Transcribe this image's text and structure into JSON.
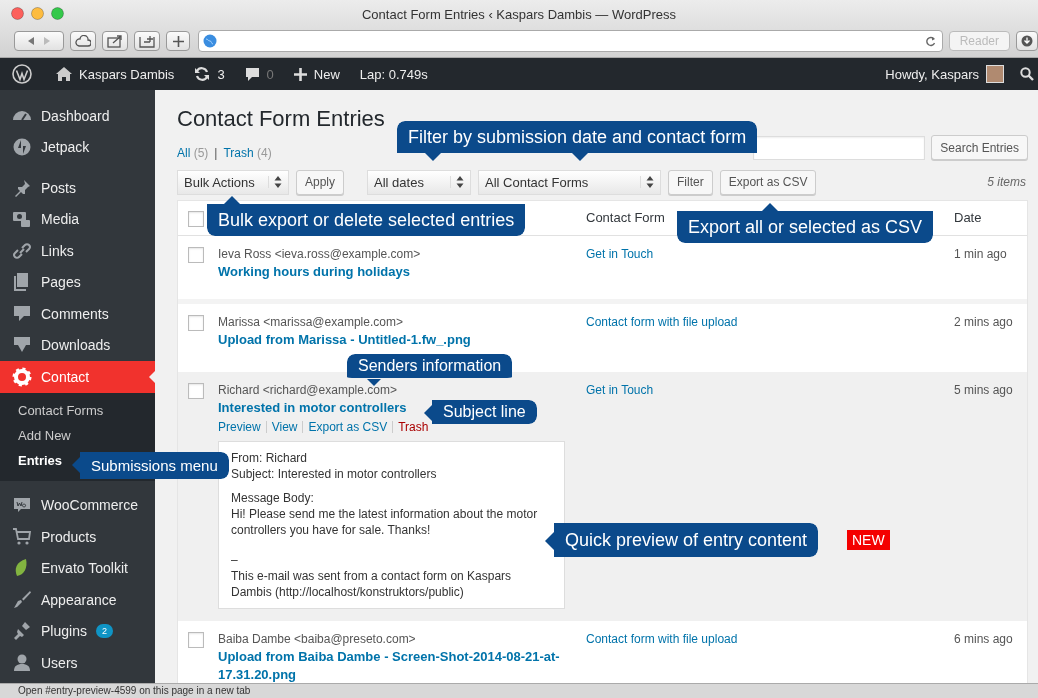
{
  "browser": {
    "title": "Contact Form Entries ‹ Kaspars Dambis — WordPress",
    "reader_button": "Reader"
  },
  "admin_bar": {
    "site": "Kaspars Dambis",
    "updates": "3",
    "comments": "0",
    "new": "New",
    "timer": "Lap: 0.749s",
    "greeting": "Howdy, Kaspars"
  },
  "sidebar": {
    "groups": [
      {
        "items": [
          {
            "label": "Dashboard",
            "selected": false
          },
          {
            "label": "Jetpack",
            "selected": false
          }
        ]
      },
      {
        "items": [
          {
            "label": "Posts",
            "selected": false
          },
          {
            "label": "Media",
            "selected": false
          },
          {
            "label": "Links",
            "selected": false
          },
          {
            "label": "Pages",
            "selected": false
          },
          {
            "label": "Comments",
            "selected": false
          },
          {
            "label": "Downloads",
            "selected": false
          },
          {
            "label": "Contact",
            "selected": true,
            "children": [
              {
                "label": "Contact Forms",
                "selected": false
              },
              {
                "label": "Add New",
                "selected": false
              },
              {
                "label": "Entries",
                "selected": true
              }
            ]
          }
        ]
      },
      {
        "items": [
          {
            "label": "WooCommerce",
            "selected": false
          },
          {
            "label": "Products",
            "selected": false
          },
          {
            "label": "Envato Toolkit",
            "selected": false
          },
          {
            "label": "Appearance",
            "selected": false
          },
          {
            "label": "Plugins",
            "selected": false,
            "badge": "2"
          },
          {
            "label": "Users",
            "selected": false
          }
        ]
      }
    ]
  },
  "page": {
    "title": "Contact Form Entries",
    "views": [
      {
        "label": "All",
        "count": "(5)"
      },
      {
        "label": "Trash",
        "count": "(4)"
      }
    ],
    "view_separator": "|",
    "search_button": "Search Entries",
    "toolbar": {
      "bulk_select": "Bulk Actions",
      "apply": "Apply",
      "date_select": "All dates",
      "form_select": "All Contact Forms",
      "filter": "Filter",
      "export": "Export as CSV",
      "count": "5 items"
    },
    "table": {
      "select_all_checked": false,
      "columns": [
        "Contact Form",
        "Date"
      ],
      "rows": [
        {
          "checked": false,
          "hovered": false,
          "sender": "Ieva Ross <ieva.ross@example.com>",
          "subject": "Working hours during holidays",
          "form": "Get in Touch",
          "date": "1 min ago"
        },
        {
          "checked": false,
          "hovered": false,
          "sender": "Marissa <marissa@example.com>",
          "subject": "Upload from Marissa - Untitled-1.fw_.png",
          "form": "Contact form with file upload",
          "date": "2 mins ago"
        },
        {
          "checked": false,
          "hovered": true,
          "sender": "Richard <richard@example.com>",
          "subject": "Interested in motor controllers",
          "form": "Get in Touch",
          "date": "5 mins ago",
          "actions": [
            {
              "label": "Preview",
              "kind": "link"
            },
            {
              "label": "View",
              "kind": "link"
            },
            {
              "label": "Export as CSV",
              "kind": "link"
            },
            {
              "label": "Trash",
              "kind": "delete"
            }
          ],
          "preview": [
            [
              "From: Richard",
              "Subject: Interested in motor controllers"
            ],
            [
              "Message Body:",
              "Hi! Please send me the latest information about the motor controllers you have for sale. Thanks!"
            ],
            [
              "–",
              "This e-mail was sent from a contact form on Kaspars Dambis (http://localhost/konstruktors/public)"
            ]
          ]
        },
        {
          "checked": false,
          "hovered": false,
          "sender": "Baiba Dambe <baiba@preseto.com>",
          "subject": "Upload from Baiba Dambe - Screen-Shot-2014-08-21-at-17.31.20.png",
          "form": "Contact form with file upload",
          "date": "6 mins ago"
        }
      ]
    }
  },
  "callouts": [
    {
      "text": "Filter by submission date and contact form"
    },
    {
      "text": "Bulk export or delete selected entries"
    },
    {
      "text": "Export all or selected as CSV"
    },
    {
      "text": "Senders information"
    },
    {
      "text": "Subject line"
    },
    {
      "text": "Submissions menu"
    },
    {
      "text": "Quick preview of entry content",
      "badge": "NEW"
    }
  ],
  "status_bar": "Open #entry-preview-4599 on this page in a new tab"
}
